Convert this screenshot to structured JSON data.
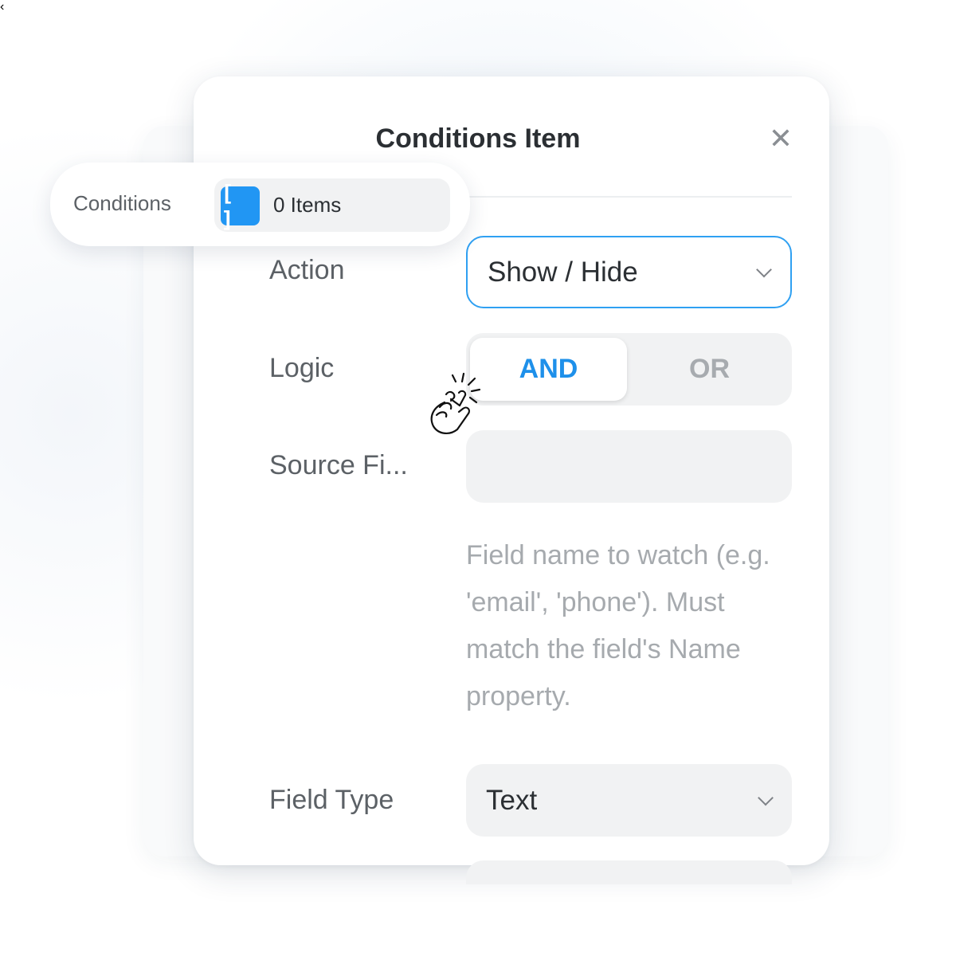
{
  "panel": {
    "title": "Conditions Item",
    "back_icon": "chevron-left-icon",
    "close_icon": "close-icon"
  },
  "tooltip": {
    "label": "Conditions",
    "icon": "brackets-icon",
    "icon_glyph": "[ ]",
    "items_text": "0 Items"
  },
  "fields": {
    "action": {
      "label": "Action",
      "value": "Show / Hide"
    },
    "logic": {
      "label": "Logic",
      "options": [
        "AND",
        "OR"
      ],
      "selected": "AND"
    },
    "source_field": {
      "label": "Source Fi...",
      "value": "",
      "help": "Field name to watch (e.g. 'email', 'phone'). Must match the field's Name property."
    },
    "field_type": {
      "label": "Field Type",
      "value": "Text"
    }
  },
  "colors": {
    "accent": "#2196f3",
    "focus_border": "#2fa0f2",
    "selected_text": "#1e90ea"
  }
}
